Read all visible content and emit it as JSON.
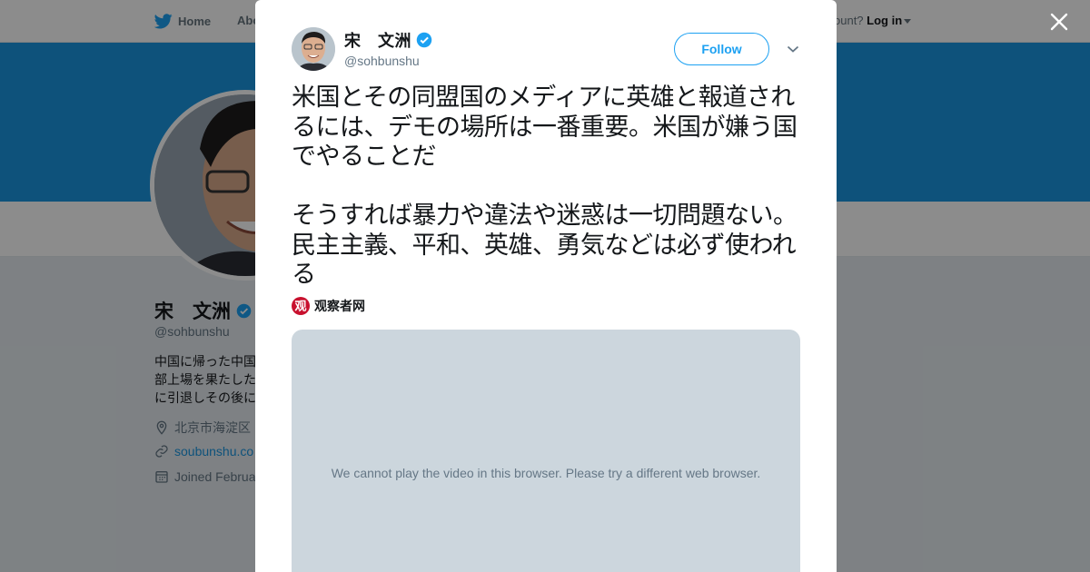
{
  "colors": {
    "brand_blue": "#1da1f2",
    "banner_blue": "#1b95e0",
    "text_primary": "#14171a",
    "text_secondary": "#657786",
    "video_placeholder": "#ccd6dd"
  },
  "nav": {
    "home_label": "Home",
    "about_label": "Abo",
    "account_prompt": "ccount?",
    "login_label": "Log in",
    "icons": {
      "logo": "twitter-bird-icon",
      "login_dropdown": "caret-down-icon"
    }
  },
  "profile": {
    "name": "宋　文洲",
    "handle": "@sohbunshu",
    "bio_lines": [
      "中国に帰った中国",
      "部上場を果たした",
      "に引退しその後に"
    ],
    "location": "北京市海淀区",
    "website": "soubunshu.co",
    "joined": "Joined Februa",
    "icons": {
      "location": "map-pin-icon",
      "website": "link-icon",
      "joined": "calendar-icon",
      "verified": "verified-badge-icon"
    }
  },
  "tweet": {
    "author_name": "宋　文洲",
    "author_handle": "@sohbunshu",
    "follow_label": "Follow",
    "text": "米国とその同盟国のメディアに英雄と報道されるには、デモの場所は一番重要。米国が嫌う国でやることだ\n\nそうすれば暴力や違法や迷惑は一切問題ない。民主主義、平和、英雄、勇気などは必ず使われる",
    "source_name": "观察者网",
    "source_logo_text": "观",
    "video_message": "We cannot play the video in this browser. Please try a different web browser.",
    "icons": {
      "verified": "verified-badge-icon",
      "more": "chevron-down-icon",
      "close": "close-icon"
    }
  }
}
